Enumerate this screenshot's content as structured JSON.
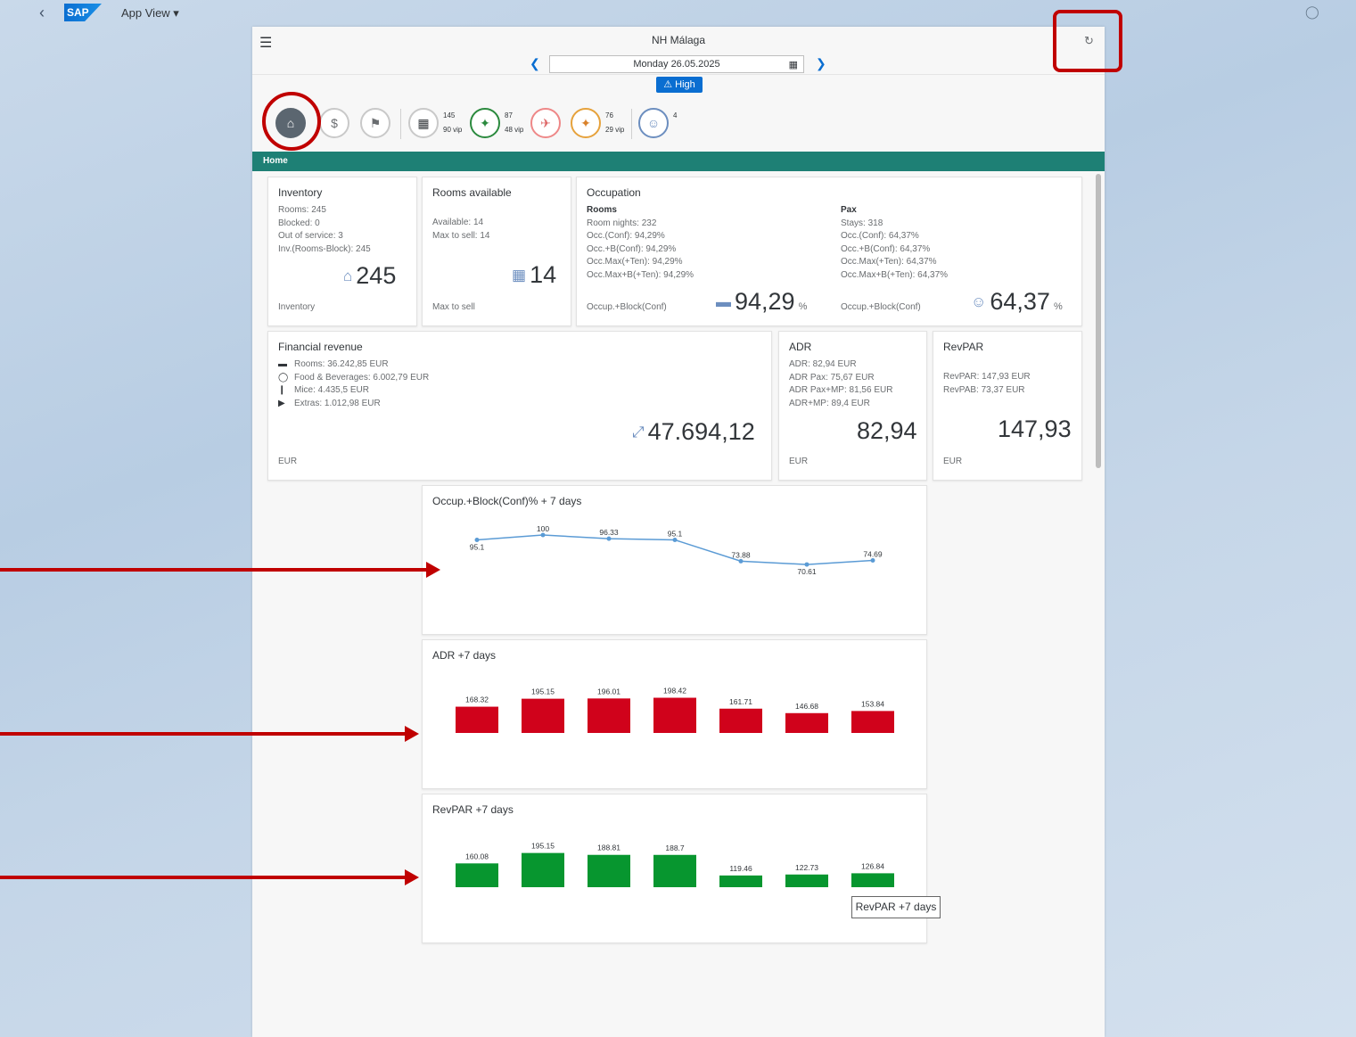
{
  "shell": {
    "app_title": "App View ▾",
    "logo": "SAP"
  },
  "header": {
    "title": "NH Málaga",
    "date": "Monday 26.05.2025",
    "badge": "⚠ High"
  },
  "toolbar": {
    "counts": [
      {
        "main": "145",
        "sub": "90 vip"
      },
      {
        "main": "87",
        "sub": "48 vip"
      },
      {
        "main": "76",
        "sub": "29 vip"
      },
      {
        "main": "4",
        "sub": ""
      }
    ]
  },
  "section_label": "Home",
  "inventory": {
    "title": "Inventory",
    "lines": [
      "Rooms: 245",
      "Blocked: 0",
      "Out of service: 3",
      "Inv.(Rooms-Block): 245"
    ],
    "value": "245",
    "footer": "Inventory"
  },
  "rooms_available": {
    "title": "Rooms available",
    "lines": [
      "Available: 14",
      "Max to sell: 14"
    ],
    "value": "14",
    "footer": "Max to sell"
  },
  "occupation": {
    "title": "Occupation",
    "rooms_head": "Rooms",
    "rooms_lines": [
      "Room nights: 232",
      "Occ.(Conf): 94,29%",
      "Occ.+B(Conf): 94,29%",
      "Occ.Max(+Ten): 94,29%",
      "Occ.Max+B(+Ten): 94,29%"
    ],
    "rooms_footer": "Occup.+Block(Conf)",
    "rooms_value": "94,29",
    "pax_head": "Pax",
    "pax_lines": [
      "Stays: 318",
      "Occ.(Conf): 64,37%",
      "Occ.+B(Conf): 64,37%",
      "Occ.Max(+Ten): 64,37%",
      "Occ.Max+B(+Ten): 64,37%"
    ],
    "pax_footer": "Occup.+Block(Conf)",
    "pax_value": "64,37",
    "unit": "%"
  },
  "financial": {
    "title": "Financial revenue",
    "lines": [
      "Rooms: 36.242,85 EUR",
      "Food & Beverages: 6.002,79 EUR",
      "Mice: 4.435,5 EUR",
      "Extras: 1.012,98 EUR"
    ],
    "value": "47.694,12",
    "footer": "EUR"
  },
  "adr": {
    "title": "ADR",
    "lines": [
      "ADR: 82,94 EUR",
      "ADR Pax: 75,67 EUR",
      "ADR Pax+MP: 81,56 EUR",
      "ADR+MP: 89,4 EUR"
    ],
    "value": "82,94",
    "footer": "EUR"
  },
  "revpar": {
    "title": "RevPAR",
    "lines": [
      "RevPAR: 147,93 EUR",
      "RevPAB: 73,37 EUR"
    ],
    "value": "147,93",
    "footer": "EUR"
  },
  "tooltip": "RevPAR +7 days",
  "colors": {
    "adr_bar": "#d0021b",
    "revpar_bar": "#07962f",
    "line": "#5b9bd5",
    "header_bar": "#1e8075",
    "annotation": "#c00000"
  },
  "chart_data": [
    {
      "type": "line",
      "title": "Occup.+Block(Conf)% + 7 days",
      "values": [
        95.1,
        100,
        96.33,
        95.1,
        73.88,
        70.61,
        74.69
      ],
      "labels": [
        "95.1",
        "100",
        "96.33",
        "95.1",
        "73.88",
        "70.61",
        "74.69"
      ]
    },
    {
      "type": "bar",
      "title": "ADR +7 days",
      "values": [
        168.32,
        195.15,
        196.01,
        198.42,
        161.71,
        146.68,
        153.84
      ],
      "labels": [
        "168.32",
        "195.15",
        "196.01",
        "198.42",
        "161.71",
        "146.68",
        "153.84"
      ]
    },
    {
      "type": "bar",
      "title": "RevPAR +7 days",
      "values": [
        160.08,
        195.15,
        188.81,
        188.7,
        119.46,
        122.73,
        126.84
      ],
      "labels": [
        "160.08",
        "195.15",
        "188.81",
        "188.7",
        "119.46",
        "122.73",
        "126.84"
      ]
    }
  ]
}
